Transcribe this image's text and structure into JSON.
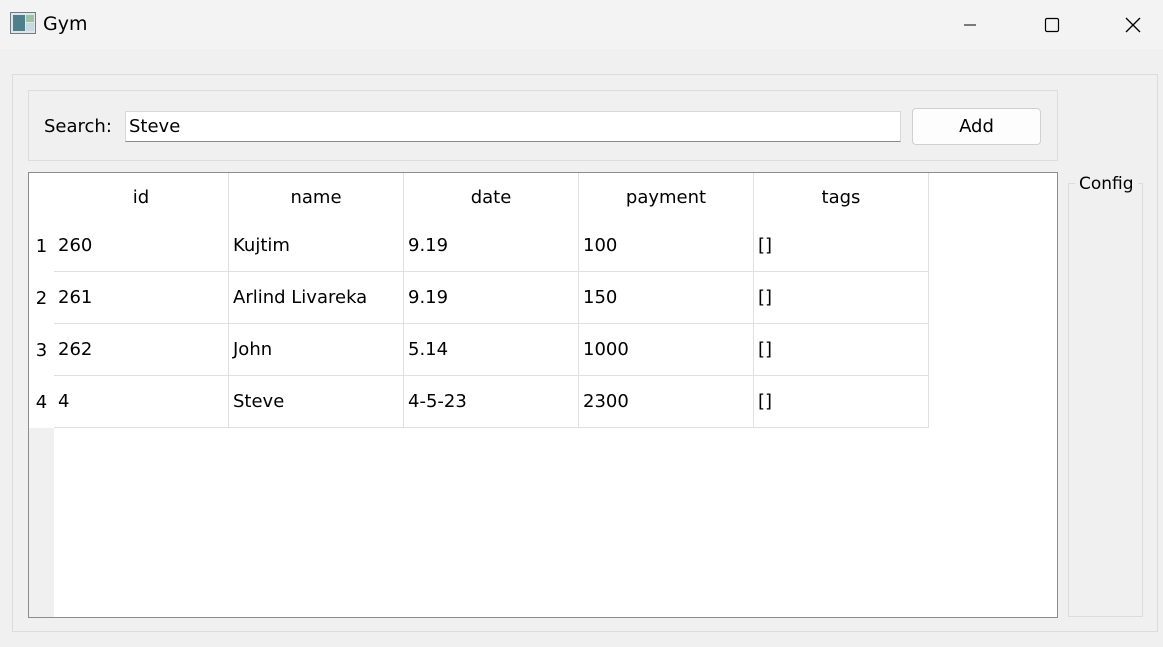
{
  "window": {
    "title": "Gym",
    "controls": [
      "minimize-icon",
      "maximize-icon",
      "close-icon"
    ]
  },
  "search": {
    "label": "Search:",
    "value": "Steve",
    "add_label": "Add"
  },
  "table": {
    "columns": [
      "id",
      "name",
      "date",
      "payment",
      "tags"
    ],
    "rows": [
      {
        "num": "1",
        "cells": [
          "260",
          "Kujtim",
          "9.19",
          "100",
          "[]"
        ]
      },
      {
        "num": "2",
        "cells": [
          "261",
          "Arlind Livareka",
          "9.19",
          "150",
          "[]"
        ]
      },
      {
        "num": "3",
        "cells": [
          "262",
          "John",
          "5.14",
          "1000",
          "[]"
        ]
      },
      {
        "num": "4",
        "cells": [
          "4",
          "Steve",
          "4-5-23",
          "2300",
          "[]"
        ]
      }
    ]
  },
  "config": {
    "label": "Config"
  }
}
